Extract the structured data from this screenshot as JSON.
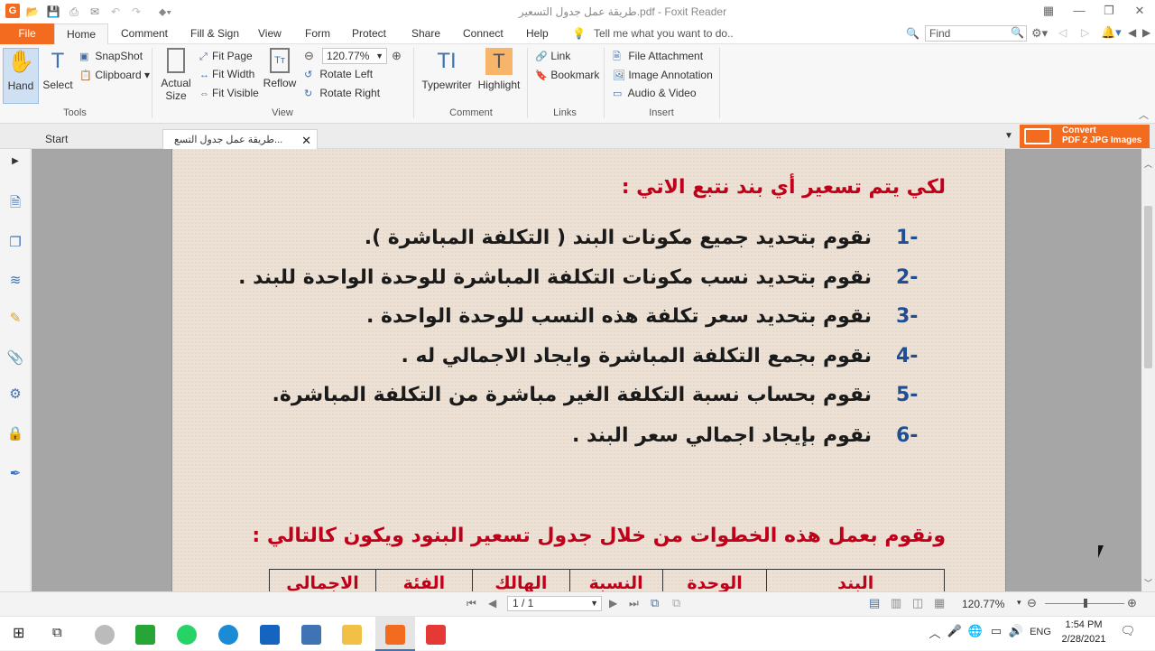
{
  "window": {
    "title": "طريقة عمل جدول التسعير.pdf - Foxit Reader"
  },
  "menu": {
    "items": [
      "File",
      "Home",
      "Comment",
      "Fill & Sign",
      "View",
      "Form",
      "Protect",
      "Share",
      "Connect",
      "Help"
    ],
    "tell_me": "Tell me what you want to do..",
    "find_placeholder": "Find"
  },
  "ribbon": {
    "tools": {
      "hand": "Hand",
      "select": "Select",
      "snapshot": "SnapShot",
      "clipboard": "Clipboard",
      "label": "Tools"
    },
    "view": {
      "actual_size_1": "Actual",
      "actual_size_2": "Size",
      "fit_page": "Fit Page",
      "fit_width": "Fit Width",
      "fit_visible": "Fit Visible",
      "reflow": "Reflow",
      "zoom": "120.77%",
      "rotate_left": "Rotate Left",
      "rotate_right": "Rotate Right",
      "label": "View"
    },
    "comment": {
      "typewriter": "Typewriter",
      "highlight": "Highlight",
      "label": "Comment"
    },
    "links": {
      "link": "Link",
      "bookmark": "Bookmark",
      "label": "Links"
    },
    "insert": {
      "file_attachment": "File Attachment",
      "image_annotation": "Image Annotation",
      "audio_video": "Audio & Video",
      "label": "Insert"
    }
  },
  "tabs": {
    "start": "Start",
    "doc": "طريقة عمل جدول التسع...",
    "convert_1": "Convert",
    "convert_2": "PDF 2 JPG Images"
  },
  "document": {
    "heading": "لكي يتم تسعير أي بند نتبع الاتي :",
    "steps": [
      {
        "num": "1-",
        "text": "نقوم بتحديد جميع مكونات البند ( التكلفة المباشرة )."
      },
      {
        "num": "2-",
        "text": "نقوم بتحديد نسب مكونات التكلفة المباشرة للوحدة الواحدة للبند ."
      },
      {
        "num": "3-",
        "text": "نقوم بتحديد سعر تكلفة هذه النسب للوحدة الواحدة ."
      },
      {
        "num": "4-",
        "text": "نقوم بجمع التكلفة المباشرة وايجاد الاجمالي له ."
      },
      {
        "num": "5-",
        "text": "نقوم بحساب نسبة التكلفة الغير مباشرة من التكلفة المباشرة."
      },
      {
        "num": "6-",
        "text": "نقوم بإيجاد اجمالي سعر البند ."
      }
    ],
    "subheading": "ونقوم بعمل هذه الخطوات من خلال جدول تسعير البنود ويكون كالتالي :",
    "table_headers": [
      "البند",
      "الوحدة",
      "النسبة",
      "الهالك",
      "الفئة",
      "الاجمالي"
    ]
  },
  "status": {
    "page": "1 / 1",
    "zoom": "120.77%"
  },
  "taskbar": {
    "lang": "ENG",
    "time": "1:54 PM",
    "date": "2/28/2021"
  }
}
